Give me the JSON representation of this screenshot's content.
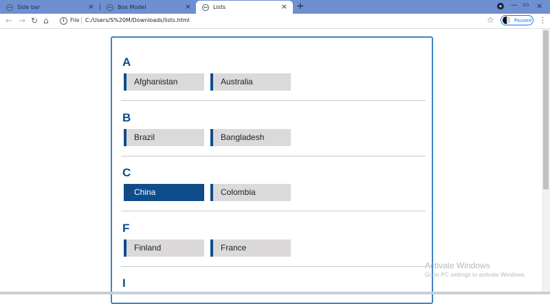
{
  "browser": {
    "tabs": [
      {
        "label": "Side bar",
        "active": false
      },
      {
        "label": "Box Model",
        "active": false
      },
      {
        "label": "Lists",
        "active": true
      }
    ],
    "new_tab_symbol": "+",
    "window_controls": {
      "minimize": "—",
      "maximize": "▭"
    },
    "address": {
      "scheme_label": "File",
      "path": "C:/Users/S%20M/Downloads/lists.html"
    },
    "profile_status": "Paused"
  },
  "page": {
    "groups": [
      {
        "letter": "A",
        "items": [
          "Afghanistan",
          "Australia"
        ]
      },
      {
        "letter": "B",
        "items": [
          "Brazil",
          "Bangladesh"
        ]
      },
      {
        "letter": "C",
        "items": [
          "China",
          "Colombia"
        ],
        "highlighted": "China"
      },
      {
        "letter": "F",
        "items": [
          "Finland",
          "France"
        ]
      },
      {
        "letter": "I",
        "items": []
      }
    ]
  },
  "watermark": {
    "title": "Activate Windows",
    "subtitle": "Go to PC settings to activate Windows."
  },
  "colors": {
    "accent": "#0f4c8a",
    "item_bg": "#dbd9da",
    "card_border": "#3d82c4",
    "tabstrip": "#6e8fd2"
  }
}
